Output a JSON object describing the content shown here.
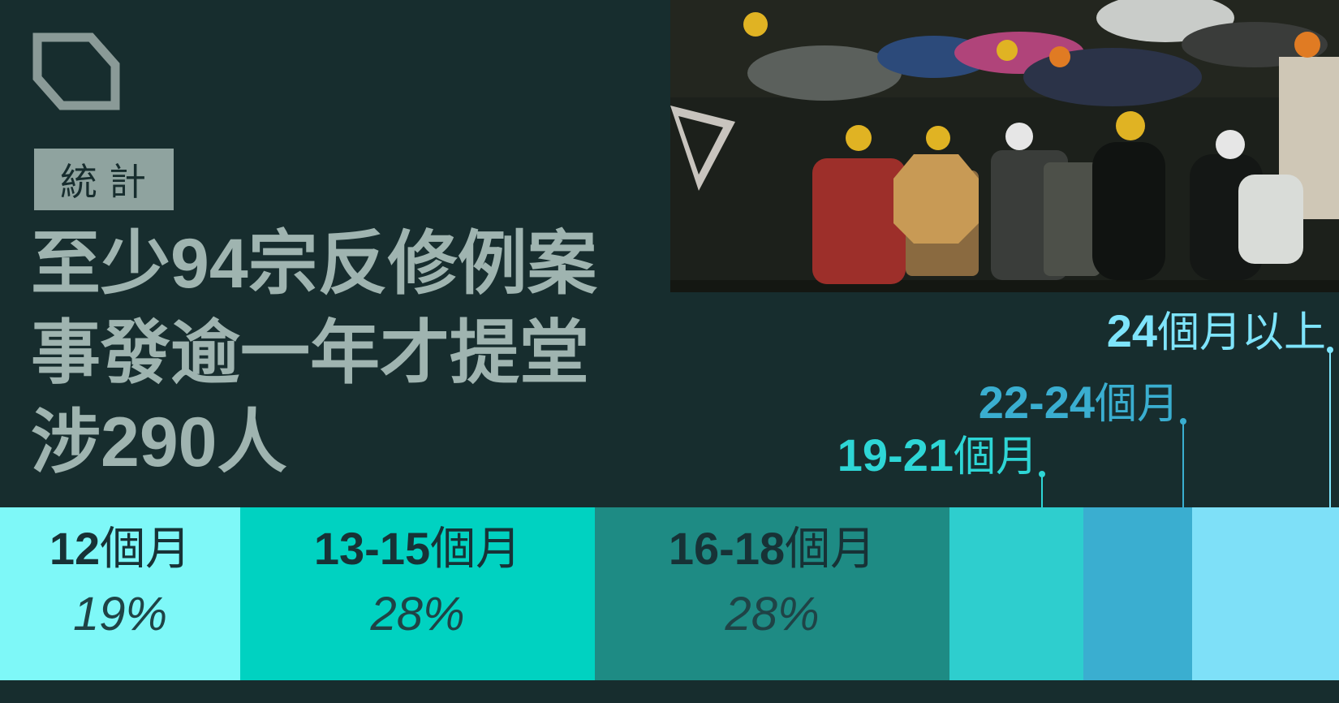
{
  "tag": "統計",
  "headline": [
    "至少94宗反修例案",
    "事發逾一年才提堂",
    "涉290人"
  ],
  "colors": {
    "background": "#172d2e",
    "headline": "#9fb4b0",
    "tag_bg": "#8fa39f"
  },
  "chart_data": {
    "type": "bar",
    "categories": [
      "12個月",
      "13-15個月",
      "16-18個月",
      "19-21個月",
      "22-24個月",
      "24個月以上"
    ],
    "values": [
      19,
      28,
      28,
      null,
      null,
      null
    ],
    "segments": [
      {
        "num": "12",
        "unit": "個月",
        "pct": "19%",
        "share": 19,
        "color": "#7ef8f8"
      },
      {
        "num": "13-15",
        "unit": "個月",
        "pct": "28%",
        "share": 28,
        "color": "#00d2c1"
      },
      {
        "num": "16-18",
        "unit": "個月",
        "pct": "28%",
        "share": 28,
        "color": "#1e8b84"
      },
      {
        "num": "19-21",
        "unit": "個月",
        "pct": "",
        "share": 10.6,
        "color": "#2ecece"
      },
      {
        "num": "22-24",
        "unit": "個月",
        "pct": "",
        "share": 8.6,
        "color": "#3aaed0"
      },
      {
        "num": "24",
        "unit": "個月以上",
        "pct": "",
        "share": 11.6,
        "color": "#7ee0f8"
      }
    ]
  }
}
